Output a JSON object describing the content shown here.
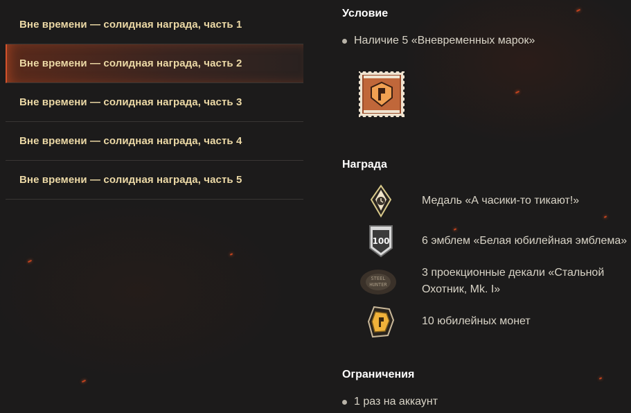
{
  "nav": {
    "items": [
      {
        "label": "Вне времени — солидная награда, часть 1",
        "active": false
      },
      {
        "label": "Вне времени — солидная награда, часть 2",
        "active": true
      },
      {
        "label": "Вне времени — солидная награда, часть 3",
        "active": false
      },
      {
        "label": "Вне времени — солидная награда, часть 4",
        "active": false
      },
      {
        "label": "Вне времени — солидная награда, часть 5",
        "active": false
      }
    ]
  },
  "condition": {
    "title": "Условие",
    "items": [
      "Наличие 5 «Вневременных марок»"
    ],
    "stamp_icon": "timeless-stamp-icon"
  },
  "reward": {
    "title": "Награда",
    "items": [
      {
        "icon": "medal-icon",
        "text": "Медаль «А часики-то тикают!»"
      },
      {
        "icon": "anniversary-emblem-icon",
        "text": "6 эмблем «Белая юбилейная эмблема»"
      },
      {
        "icon": "projection-decal-icon",
        "text": "3 проекционные декали «Стальной Охотник, Mk. I»"
      },
      {
        "icon": "anniversary-coin-icon",
        "text": "10 юбилейных монет"
      }
    ]
  },
  "restrictions": {
    "title": "Ограничения",
    "items": [
      "1 раз на аккаунт"
    ]
  },
  "colors": {
    "background": "#1c1b1b",
    "nav_text": "#ecd9a6",
    "accent": "#d4522b",
    "body_text": "#d9d4c7",
    "heading": "#ffffff"
  }
}
